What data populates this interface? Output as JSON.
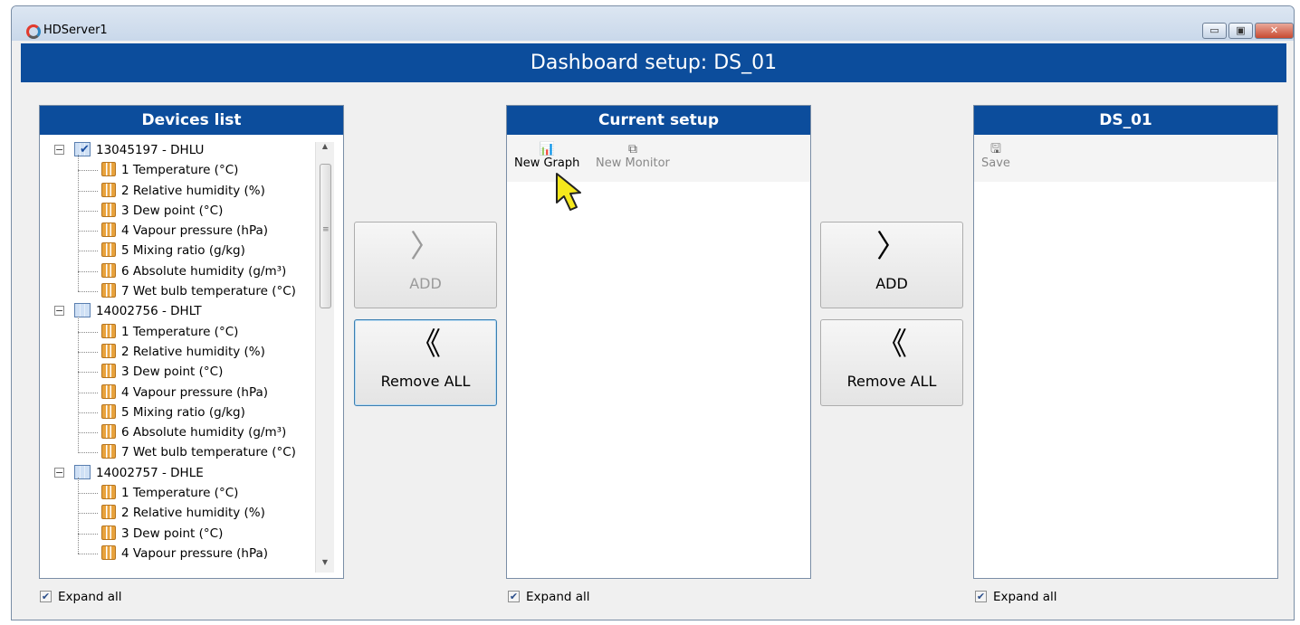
{
  "window": {
    "title": "HDServer1",
    "minimize_glyph": "▭",
    "maximize_glyph": "▣",
    "close_glyph": "✕"
  },
  "header": {
    "title": "Dashboard setup: DS_01"
  },
  "devices_panel": {
    "title": "Devices list",
    "expand_all_label": "Expand all",
    "expand_all_checked": true,
    "devices": [
      {
        "label": "13045197 - DHLU",
        "checked": true,
        "channels": [
          "1 Temperature (°C)",
          "2 Relative humidity (%)",
          "3 Dew point (°C)",
          "4 Vapour pressure (hPa)",
          "5 Mixing ratio (g/kg)",
          "6 Absolute humidity (g/m³)",
          "7 Wet bulb temperature (°C)"
        ]
      },
      {
        "label": "14002756 - DHLT",
        "checked": false,
        "channels": [
          "1 Temperature (°C)",
          "2 Relative humidity (%)",
          "3 Dew point (°C)",
          "4 Vapour pressure (hPa)",
          "5 Mixing ratio (g/kg)",
          "6 Absolute humidity (g/m³)",
          "7 Wet bulb temperature (°C)"
        ]
      },
      {
        "label": "14002757 - DHLE",
        "checked": false,
        "channels": [
          "1 Temperature (°C)",
          "2 Relative humidity (%)",
          "3 Dew point (°C)",
          "4 Vapour pressure (hPa)"
        ]
      }
    ]
  },
  "left_buttons": {
    "add_label": "ADD",
    "add_glyph": "〉",
    "remove_label": "Remove ALL",
    "remove_glyph": "《"
  },
  "current_panel": {
    "title": "Current setup",
    "new_graph_label": "New Graph",
    "new_graph_icon": "📊",
    "new_monitor_label": "New Monitor",
    "new_monitor_icon": "⧉",
    "expand_all_label": "Expand all",
    "expand_all_checked": true
  },
  "right_buttons": {
    "add_label": "ADD",
    "add_glyph": "〉",
    "remove_label": "Remove ALL",
    "remove_glyph": "《"
  },
  "ds_panel": {
    "title": "DS_01",
    "save_label": "Save",
    "save_icon": "🖫",
    "expand_all_label": "Expand all",
    "expand_all_checked": true
  },
  "colors": {
    "header_blue": "#0c4d9c",
    "cursor_yellow": "#f5e81c"
  }
}
